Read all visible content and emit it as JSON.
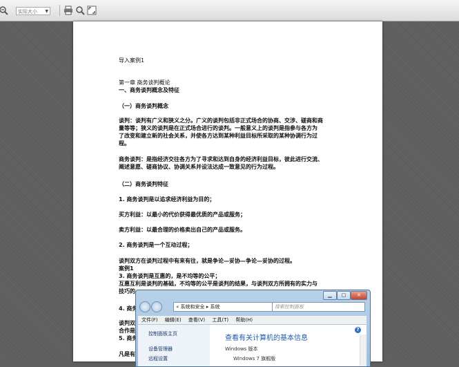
{
  "toolbar": {
    "zoom_select_value": "实际大小",
    "icons": [
      "zoom-out-icon",
      "print-icon",
      "search-icon",
      "fullscreen-icon"
    ]
  },
  "document": {
    "lines": [
      {
        "text": "导入案例1",
        "bold": false
      },
      {
        "text": "第一章    商务谈判概论",
        "bold": false
      },
      {
        "text": "一、商务谈判概念及特征",
        "bold": true
      },
      {
        "text": "（一）商务谈判概念",
        "bold": true
      },
      {
        "text": "谈判：谈判有广义和狭义之分。广义的谈判包括非正式场合的协商、交涉、磋商和商",
        "bold": true
      },
      {
        "text": "量等等；狭义的谈判是在正式场合进行的谈判。一般意义上的谈判是指参与各方为",
        "bold": true
      },
      {
        "text": "了改变和建立新的社会关系，并使各方达到某种利益目标所采取的某种协调行为过",
        "bold": true
      },
      {
        "text": "程。",
        "bold": true
      },
      {
        "text": "商务谈判：是指经济交往各方为了寻求和达到自身的经济利益目标，彼此进行交流、",
        "bold": true
      },
      {
        "text": "阐述意愿、磋商协议、协调关系并设法达成一致意见的行为过程。",
        "bold": true
      },
      {
        "text": "（二）商务谈判特征",
        "bold": true
      },
      {
        "text": "1. 商务谈判是以追求经济利益为目的；",
        "bold": true
      },
      {
        "text": "买方利益：以最小的代价获得最优质的产品或服务；",
        "bold": true
      },
      {
        "text": "卖方利益：以最合理的价格卖出自己的产品或服务。",
        "bold": true
      },
      {
        "text": "2. 商务谈判是一个互动过程；",
        "bold": true
      },
      {
        "text": "谈判双方在谈判过程中有来有往，就是争论—妥协—争论—妥协的过程。",
        "bold": true
      },
      {
        "text": "案例1",
        "bold": true
      },
      {
        "text": "3. 商务谈判是互惠的，是不均等的公平；",
        "bold": true
      },
      {
        "text": "互惠互利是谈判的基础，不均等的公平是谈判的结果，与谈判双方所拥有的实力与",
        "bold": true
      },
      {
        "text": "技巧的",
        "bold": true
      },
      {
        "text": "4. 商务",
        "bold": true
      },
      {
        "text": "谈判双",
        "bold": true
      },
      {
        "text": "合作是",
        "bold": true
      },
      {
        "text": "5. 商务",
        "bold": true
      },
      {
        "text": "凡是有",
        "bold": true
      }
    ]
  },
  "window": {
    "address": "« 系统和安全 ▸ 系统",
    "search_placeholder": "搜索控制面板",
    "controls": [
      "▁",
      "□",
      "✕"
    ],
    "menu": [
      "文件(F)",
      "编辑(E)",
      "查看(V)",
      "工具(T)",
      "帮助(H)"
    ],
    "sidebar_items": [
      "控制面板主页",
      "设备管理器",
      "远程设置"
    ],
    "heading": "查看有关计算机的基本信息",
    "section": "Windows 版本",
    "edition": "Windows 7 旗舰版"
  }
}
